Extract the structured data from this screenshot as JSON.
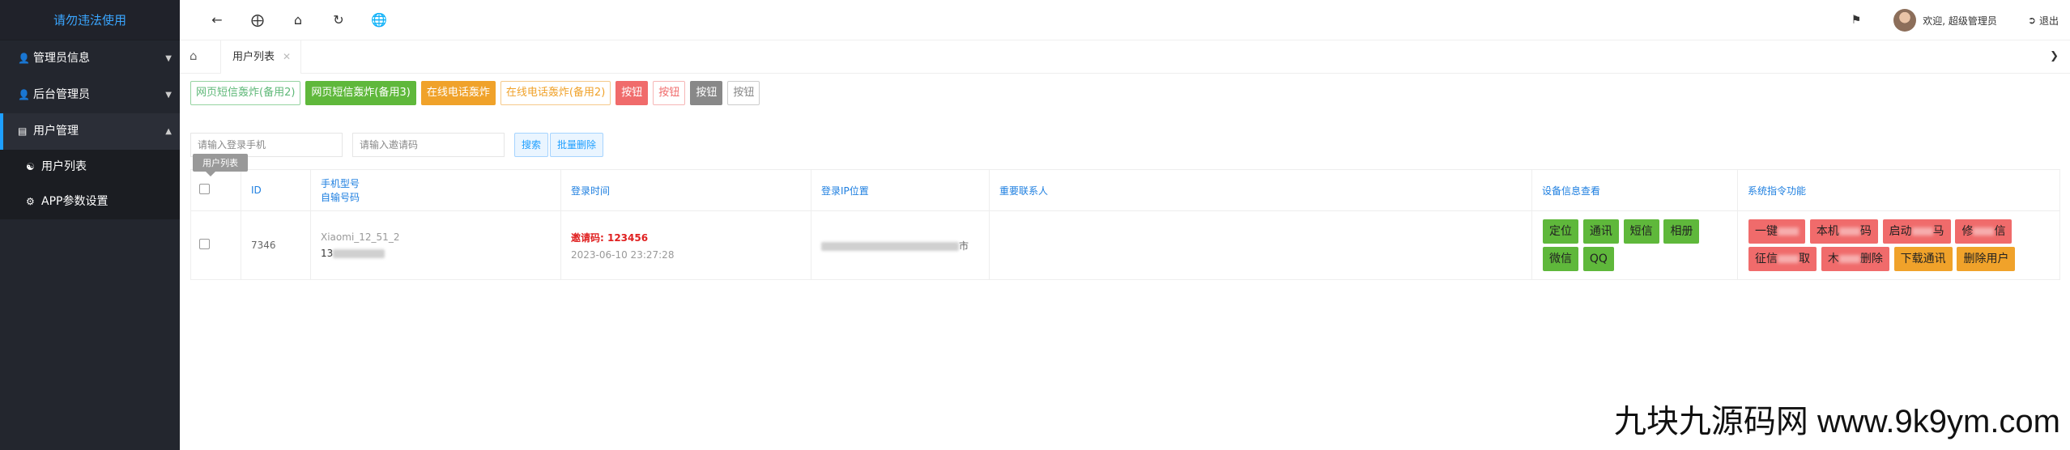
{
  "sidebar": {
    "logo": "请勿违法使用",
    "items": [
      {
        "label": "管理员信息",
        "icon": "user-icon"
      },
      {
        "label": "后台管理员",
        "icon": "user-icon"
      },
      {
        "label": "用户管理",
        "icon": "id-card-icon"
      }
    ],
    "sub_items": [
      {
        "label": "用户列表",
        "icon": "user-outline-icon"
      },
      {
        "label": "APP参数设置",
        "icon": "gear-icon"
      }
    ],
    "tooltip": "用户列表"
  },
  "header": {
    "welcome": "欢迎, 超级管理员",
    "logout": "退出"
  },
  "tabs": {
    "active": "用户列表"
  },
  "toolbar": {
    "buttons": [
      "网页短信轰炸(备用2)",
      "网页短信轰炸(备用3)",
      "在线电话轰炸",
      "在线电话轰炸(备用2)",
      "按钮",
      "按钮",
      "按钮",
      "按钮"
    ]
  },
  "search": {
    "phone_placeholder": "请输入登录手机",
    "invite_placeholder": "请输入邀请码",
    "search_label": "搜索",
    "batch_delete_label": "批量删除"
  },
  "table": {
    "headers": {
      "id": "ID",
      "model_line1": "手机型号",
      "model_line2": "自输号码",
      "login_time": "登录时间",
      "login_ip": "登录IP位置",
      "contact": "重要联系人",
      "device_info": "设备信息查看",
      "system_cmd": "系统指令功能"
    },
    "row": {
      "id": "7346",
      "model": "Xiaomi_12_51_2",
      "phone_prefix": "13",
      "invite_code": "邀请码: 123456",
      "login_time": "2023-06-10 23:27:28",
      "ip_suffix": "市",
      "device_buttons": [
        "定位",
        "通讯",
        "短信",
        "相册",
        "微信",
        "QQ"
      ],
      "cmd_buttons_row1": [
        {
          "pre": "一键",
          "post": "",
          "color": "pink"
        },
        {
          "pre": "本机",
          "post": "码",
          "color": "pink"
        },
        {
          "pre": "启动",
          "post": "马",
          "color": "pink"
        },
        {
          "pre": "修",
          "post": "信",
          "color": "pink"
        }
      ],
      "cmd_buttons_row2": [
        {
          "pre": "征信",
          "post": "取",
          "color": "pink"
        },
        {
          "pre": "木",
          "post": "删除",
          "color": "pink"
        },
        {
          "pre": "下载通讯",
          "post": "",
          "color": "orange"
        },
        {
          "pre": "删除用户",
          "post": "",
          "color": "orange"
        }
      ]
    }
  },
  "watermark": "九块九源码网 www.9k9ym.com"
}
